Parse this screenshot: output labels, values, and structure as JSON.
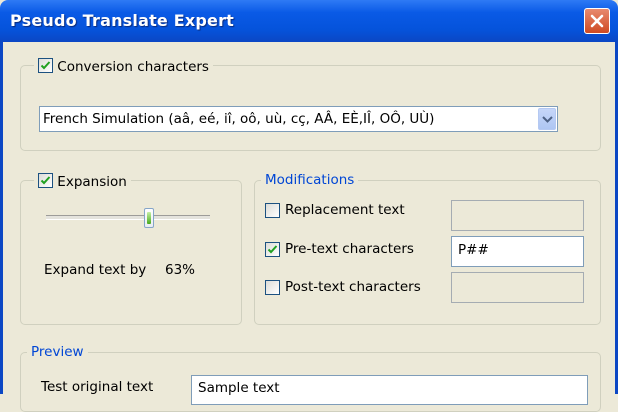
{
  "window": {
    "title": "Pseudo Translate Expert"
  },
  "conversion": {
    "label": "Conversion characters",
    "checked": true,
    "selected": "French Simulation (aâ, eé, iî, oô, uù, cç, AÂ, EÈ,IÎ, OÔ, UÙ)"
  },
  "expansion": {
    "label": "Expansion",
    "checked": true,
    "slider_value_percent": 63,
    "expand_label": "Expand text by",
    "expand_value": "63%"
  },
  "modifications": {
    "title": "Modifications",
    "replacement": {
      "label": "Replacement text",
      "checked": false,
      "value": ""
    },
    "pretext": {
      "label": "Pre-text characters",
      "checked": true,
      "value": "P##"
    },
    "posttext": {
      "label": "Post-text characters",
      "checked": false,
      "value": ""
    }
  },
  "preview": {
    "title": "Preview",
    "original_label": "Test original text",
    "original_value": "Sample text"
  },
  "colors": {
    "title_bar": "#0553db",
    "dialog_bg": "#ece9d8",
    "group_title": "#0046d5",
    "close_button": "#cf4a22",
    "check_mark": "#21a121"
  }
}
